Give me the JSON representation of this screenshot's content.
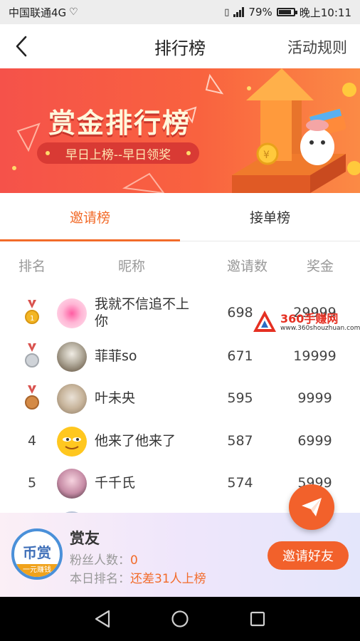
{
  "status_bar": {
    "carrier": "中国联通4G",
    "battery_percent": "79%",
    "battery_level": 0.79,
    "time": "晚上10:11"
  },
  "nav": {
    "title": "排行榜",
    "rules_label": "活动规则"
  },
  "banner": {
    "title": "赏金排行榜",
    "subtitle": "早日上榜--早日领奖"
  },
  "tabs": [
    {
      "label": "邀请榜",
      "active": true
    },
    {
      "label": "接单榜",
      "active": false
    }
  ],
  "table": {
    "headers": {
      "rank": "排名",
      "nickname": "昵称",
      "invites": "邀请数",
      "bonus": "奖金"
    },
    "rows": [
      {
        "rank": "",
        "medal": "gold",
        "nickname": "我就不信追不上你",
        "invites": "698",
        "bonus": "29999"
      },
      {
        "rank": "",
        "medal": "silver",
        "nickname": "菲菲so",
        "invites": "671",
        "bonus": "19999"
      },
      {
        "rank": "",
        "medal": "bronze",
        "nickname": "叶未央",
        "invites": "595",
        "bonus": "9999"
      },
      {
        "rank": "4",
        "medal": "",
        "nickname": "他来了他来了",
        "invites": "587",
        "bonus": "6999"
      },
      {
        "rank": "5",
        "medal": "",
        "nickname": "千千氏",
        "invites": "574",
        "bonus": "5999"
      }
    ]
  },
  "watermark": {
    "text": "360手赚网",
    "url": "www.360shouzhuan.com"
  },
  "footer": {
    "name": "赏友",
    "logo_text": "币赏",
    "logo_strip": "一元赚钱",
    "fans_label": "粉丝人数：",
    "fans_value": "0",
    "rank_label": "本日排名：",
    "rank_value": "还差31人上榜",
    "invite_button": "邀请好友"
  },
  "colors": {
    "accent": "#f26b2a",
    "banner_start": "#f5524a",
    "banner_end": "#fb8a45"
  },
  "icons": {
    "back": "chevron-left-icon",
    "fab": "paper-plane-icon",
    "system_back": "triangle-back-icon",
    "system_home": "circle-home-icon",
    "system_recent": "square-recent-icon"
  }
}
